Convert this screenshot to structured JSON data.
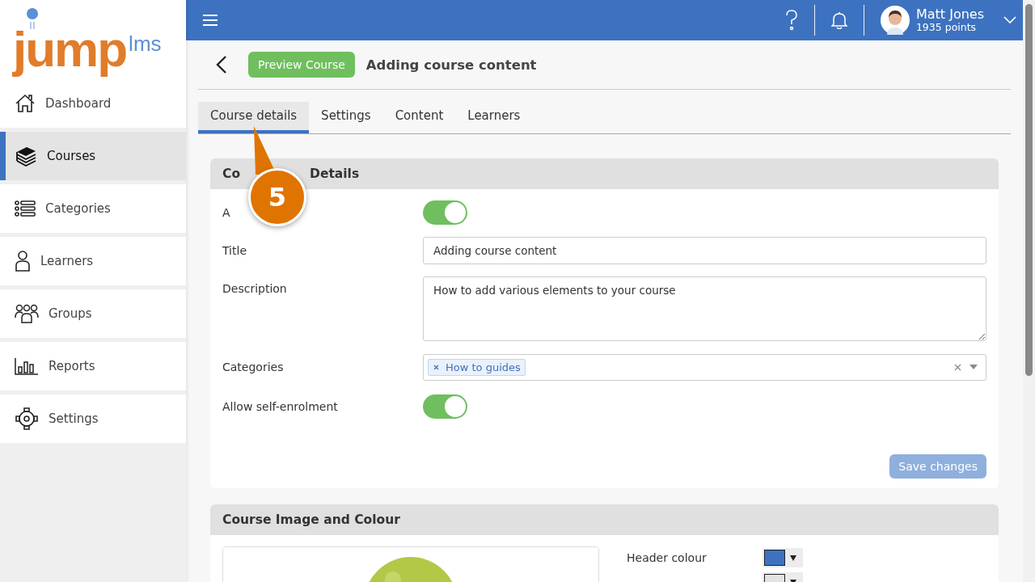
{
  "logo": {
    "main": "jump",
    "suffix": "lms"
  },
  "sidebar": {
    "items": [
      {
        "label": "Dashboard",
        "selected": false
      },
      {
        "label": "Courses",
        "selected": true
      },
      {
        "label": "Categories",
        "selected": false
      },
      {
        "label": "Learners",
        "selected": false
      },
      {
        "label": "Groups",
        "selected": false
      },
      {
        "label": "Reports",
        "selected": false
      },
      {
        "label": "Settings",
        "selected": false
      }
    ]
  },
  "user": {
    "name": "Matt Jones",
    "points": "1935 points"
  },
  "page": {
    "preview_button": "Preview Course",
    "title": "Adding course content"
  },
  "tabs": [
    {
      "label": "Course details",
      "selected": true
    },
    {
      "label": "Settings",
      "selected": false
    },
    {
      "label": "Content",
      "selected": false
    },
    {
      "label": "Learners",
      "selected": false
    }
  ],
  "details": {
    "title_parts": [
      "Co",
      "Details"
    ],
    "fields": [
      {
        "kind": "toggle",
        "label": "A",
        "on": true
      },
      {
        "kind": "text",
        "label": "Title",
        "value": "Adding course content"
      },
      {
        "kind": "textarea",
        "label": "Description",
        "value": "How to add various elements to your course"
      },
      {
        "kind": "tags",
        "label": "Categories",
        "tags": [
          "How to guides"
        ]
      },
      {
        "kind": "toggle",
        "label": "Allow self-enrolment",
        "on": true
      }
    ],
    "save_button": {
      "label": "Save changes",
      "disabled": true
    }
  },
  "callout": {
    "number": "5"
  },
  "image_section": {
    "title": "Course Image and Colour",
    "pickers": [
      {
        "label": "Header colour",
        "color": "#3d72c0"
      },
      {
        "color": "#e3e3e3"
      }
    ]
  }
}
